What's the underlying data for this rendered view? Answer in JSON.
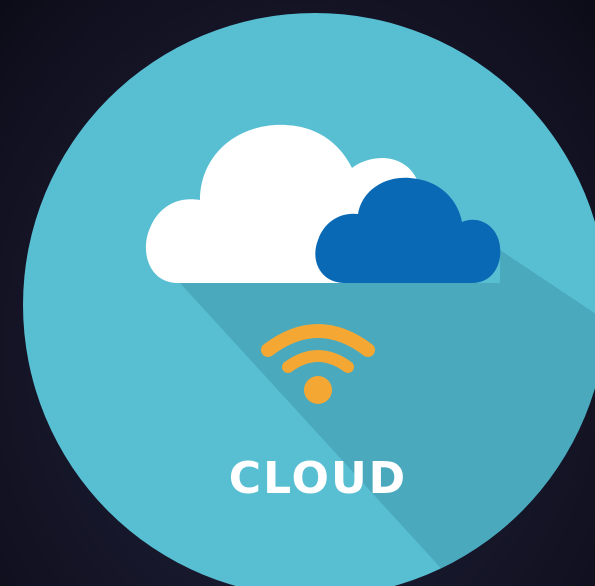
{
  "label": "CLOUD",
  "icon_names": [
    "white-cloud-icon",
    "blue-cloud-icon",
    "wifi-signal-icon"
  ],
  "colors": {
    "background_dark": "#0c0c18",
    "circle_fill": "#58bfd3",
    "long_shadow": "#4aa9bd",
    "white_cloud": "#ffffff",
    "blue_cloud": "#0969b5",
    "wifi": "#f5a733",
    "label_text": "#ffffff"
  }
}
